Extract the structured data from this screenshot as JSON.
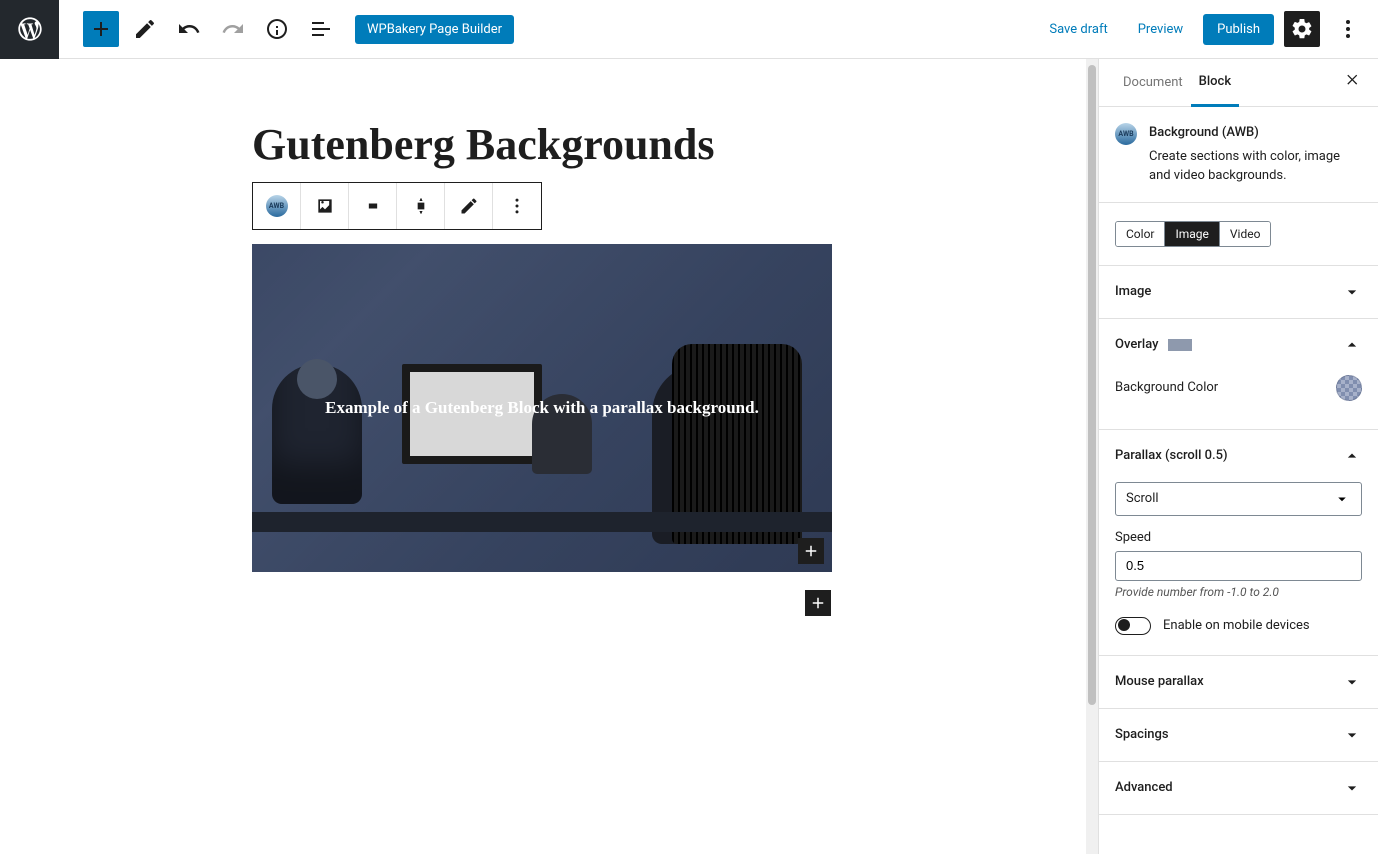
{
  "topbar": {
    "wpbakery_label": "WPBakery Page Builder",
    "save_draft": "Save draft",
    "preview": "Preview",
    "publish": "Publish"
  },
  "editor": {
    "page_title": "Gutenberg Backgrounds",
    "block_text": "Example of a Gutenberg Block with a parallax background."
  },
  "sidebar": {
    "tabs": {
      "document": "Document",
      "block": "Block"
    },
    "block_info": {
      "title": "Background (AWB)",
      "desc": "Create sections with color, image and video backgrounds."
    },
    "segments": {
      "color": "Color",
      "image": "Image",
      "video": "Video"
    },
    "panels": {
      "image": "Image",
      "overlay": "Overlay",
      "bg_color_label": "Background Color",
      "parallax": "Parallax (scroll 0.5)",
      "parallax_select": "Scroll",
      "speed_label": "Speed",
      "speed_value": "0.5",
      "speed_help": "Provide number from -1.0 to 2.0",
      "enable_mobile": "Enable on mobile devices",
      "mouse_parallax": "Mouse parallax",
      "spacings": "Spacings",
      "advanced": "Advanced"
    }
  }
}
